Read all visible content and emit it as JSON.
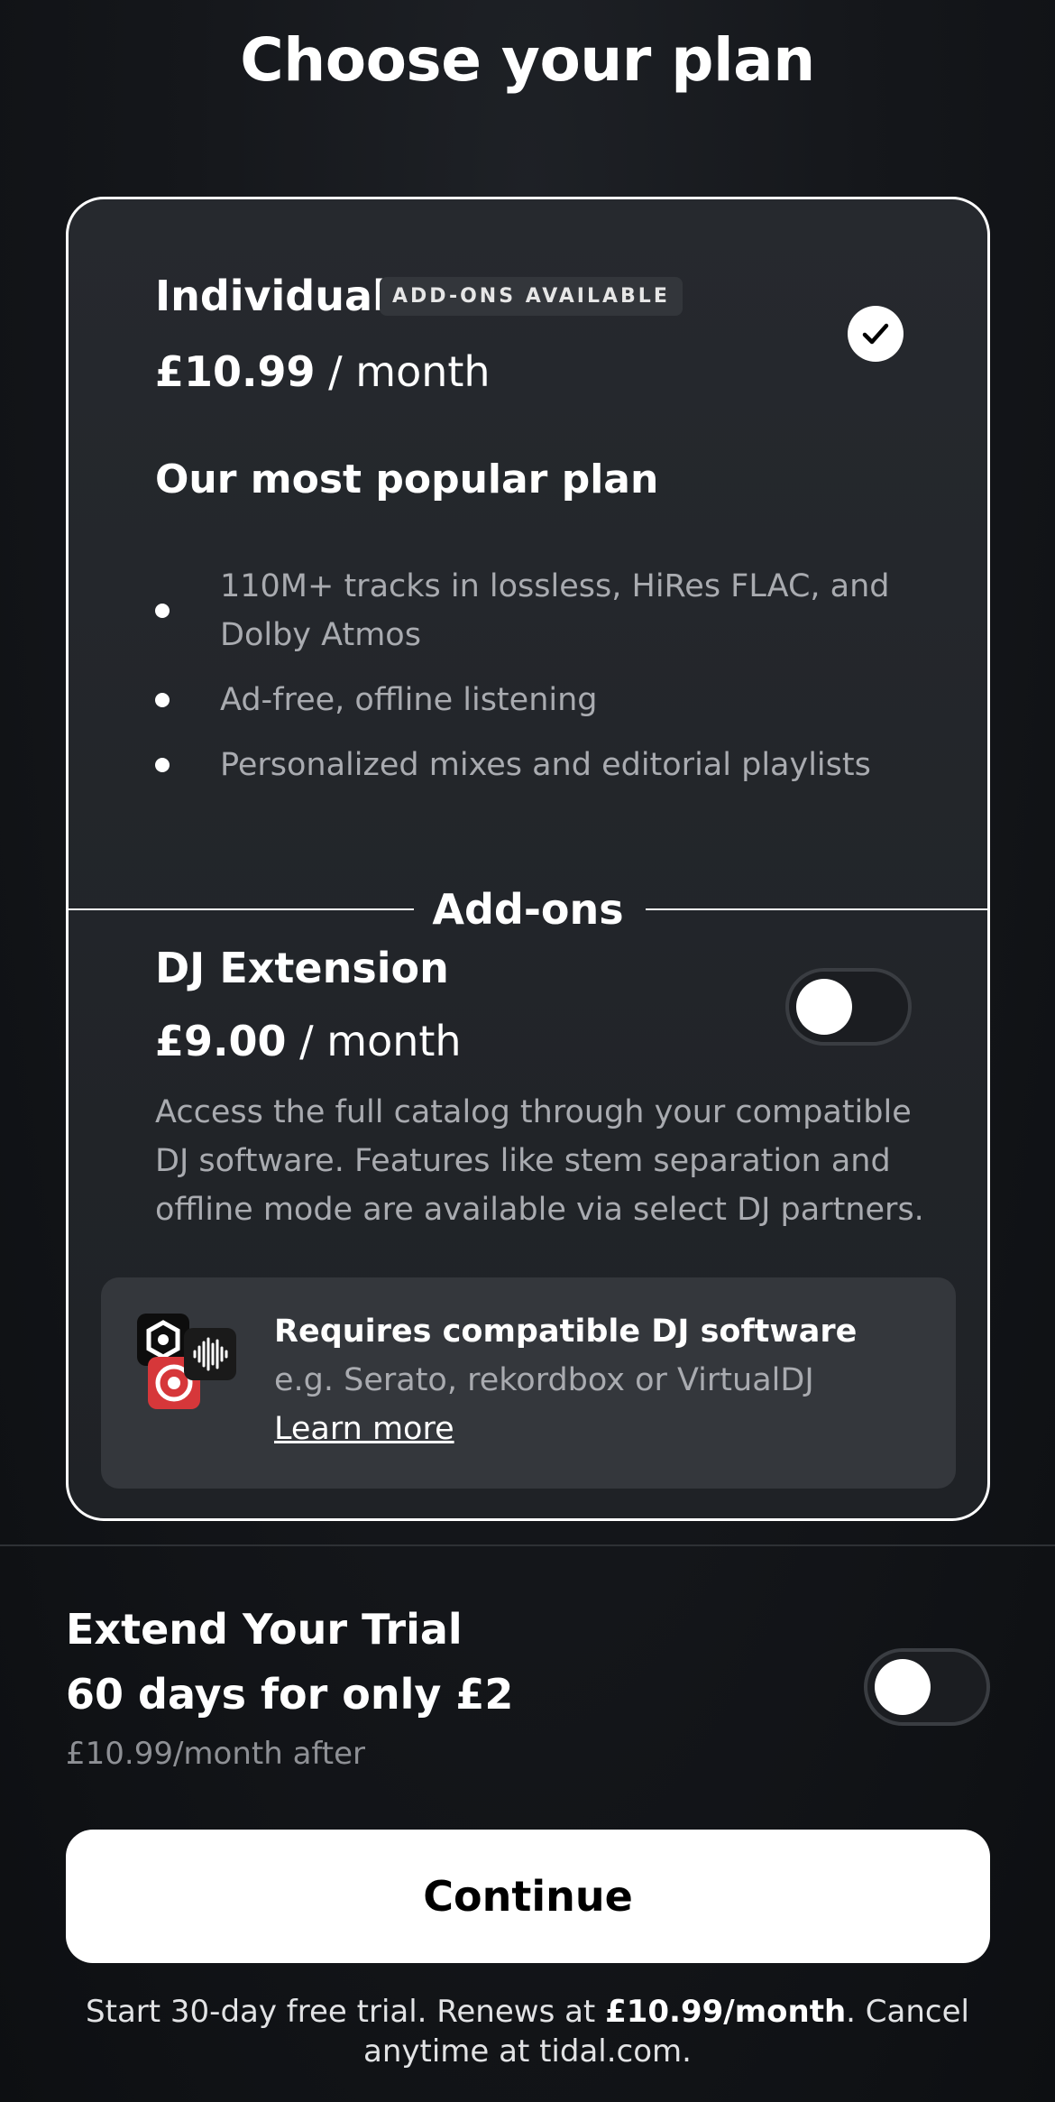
{
  "header": {
    "title": "Choose your plan"
  },
  "plan": {
    "name": "Individual",
    "badge": "ADD-ONS AVAILABLE",
    "price": "£10.99",
    "period": " / month",
    "selected": true,
    "tagline": "Our most popular plan",
    "features": [
      "110M+ tracks in lossless, HiRes FLAC, and Dolby Atmos",
      "Ad-free, offline listening",
      "Personalized mixes and editorial playlists"
    ]
  },
  "addons": {
    "heading": "Add-ons",
    "dj_extension": {
      "title": "DJ Extension",
      "price": "£9.00",
      "period": " / month",
      "enabled": false,
      "description": "Access the full catalog through your compatible DJ software. Features like stem separation and offline mode are available via select DJ partners."
    },
    "software": {
      "title": "Requires compatible DJ software",
      "subtitle": "e.g. Serato, rekordbox or VirtualDJ",
      "link": "Learn more"
    }
  },
  "trial": {
    "title": "Extend Your Trial",
    "offer": "60 days for only £2",
    "after": "£10.99/month after",
    "enabled": false
  },
  "cta": {
    "label": "Continue"
  },
  "footer": {
    "text_before": "Start 30-day free trial. Renews at ",
    "price": "£10.99/month",
    "text_after": ". Cancel anytime at tidal.com."
  },
  "colors": {
    "background": "#111317",
    "card": "#26292e",
    "muted_text": "#a9abb0",
    "accent_red": "#d6373a"
  }
}
